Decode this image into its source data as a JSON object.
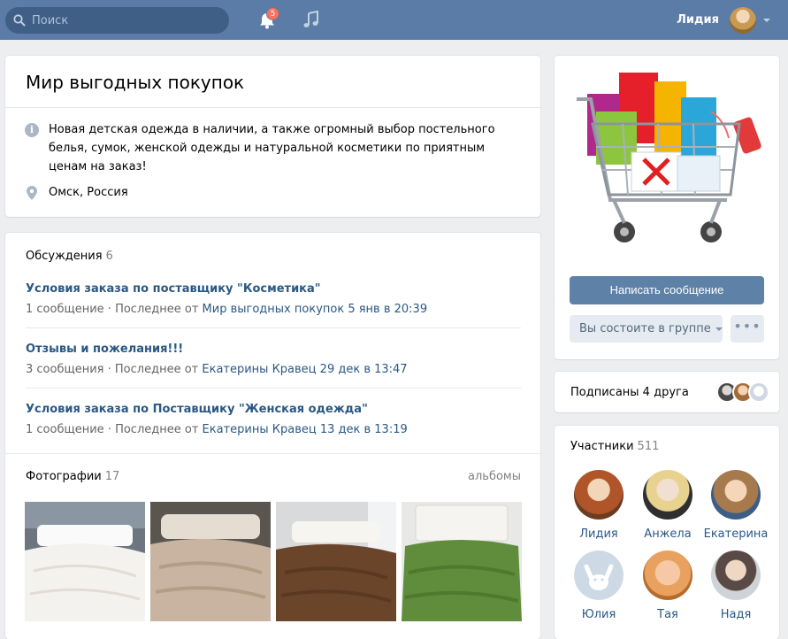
{
  "header": {
    "search_placeholder": "Поиск",
    "notifications_count": "5",
    "user_name": "Лидия"
  },
  "group": {
    "title": "Мир выгодных покупок",
    "description": "Новая детская одежда в наличии, а также огромный выбор постельного белья, сумок, женской одежды и натуральной косметики по приятным ценам на заказ!",
    "location": "Омск, Россия"
  },
  "discussions": {
    "label": "Обсуждения",
    "count": "6",
    "topics": [
      {
        "title": "Условия заказа по поставщику \"Косметика\"",
        "count": "1 сообщение",
        "last_prefix": "Последнее от",
        "author": "Мир выгодных покупок",
        "date": "5 янв в 20:39"
      },
      {
        "title": "Отзывы и пожелания!!!",
        "count": "3 сообщения",
        "last_prefix": "Последнее от",
        "author": "Екатерины Кравец",
        "date": "29 дек в 13:47"
      },
      {
        "title": "Условия заказа по Поставщику \"Женская одежда\"",
        "count": "1 сообщение",
        "last_prefix": "Последнее от",
        "author": "Екатерины Кравец",
        "date": "13 дек в 13:19"
      }
    ]
  },
  "photos": {
    "label": "Фотографии",
    "count": "17",
    "albums_link": "альбомы",
    "items": [
      {
        "name": "white-bedspread",
        "color": "#f3f1ec"
      },
      {
        "name": "beige-bedspread",
        "color": "#cbb7a3"
      },
      {
        "name": "brown-bedspread",
        "color": "#6a4429"
      },
      {
        "name": "green-bedspread",
        "color": "#5d8a3a"
      }
    ]
  },
  "actions": {
    "message_button": "Написать сообщение",
    "membership_button": "Вы состоите в группе",
    "more_button": "•••"
  },
  "friends": {
    "label": "Подписаны 4 друга"
  },
  "members": {
    "label": "Участники",
    "count": "511",
    "list": [
      {
        "name": "Лидия"
      },
      {
        "name": "Анжела"
      },
      {
        "name": "Екатерина"
      },
      {
        "name": "Юлия"
      },
      {
        "name": "Тая"
      },
      {
        "name": "Надя"
      }
    ]
  },
  "colors": {
    "header_bg": "#5a7ca6",
    "link": "#2a5885",
    "primary_button": "#5e81a8",
    "badge": "#ff6f5c"
  }
}
